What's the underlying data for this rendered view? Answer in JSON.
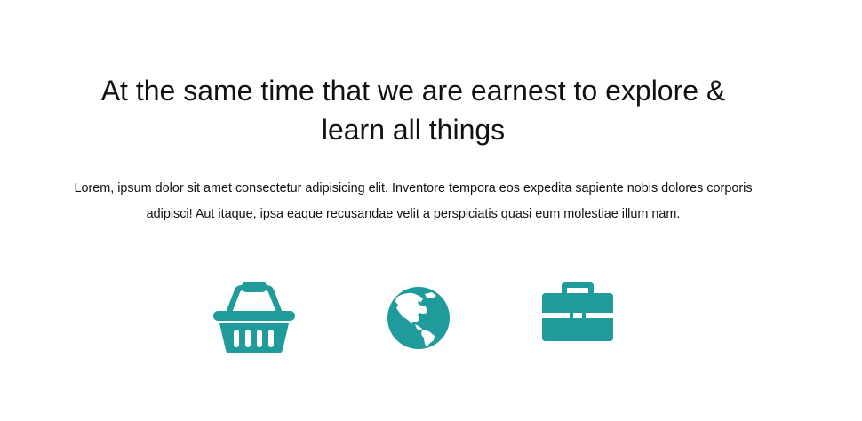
{
  "hero": {
    "heading_lines": [
      "At the same time that we are earnest to explore &",
      "learn all things"
    ],
    "paragraph_lines": [
      "Lorem, ipsum dolor sit amet consectetur adipisicing elit. Inventore tempora eos expedita sapiente nobis dolores corporis",
      "adipisci! Aut itaque, ipsa eaque recusandae velit a perspiciatis quasi eum molestiae illum nam."
    ]
  },
  "icons": [
    {
      "name": "shopping-basket-icon",
      "color": "#1f9b9c"
    },
    {
      "name": "globe-americas-icon",
      "color": "#1f9b9c"
    },
    {
      "name": "briefcase-icon",
      "color": "#1f9b9c"
    }
  ],
  "theme": {
    "accent": "#1f9b9c",
    "text": "#111111",
    "background": "#ffffff"
  }
}
